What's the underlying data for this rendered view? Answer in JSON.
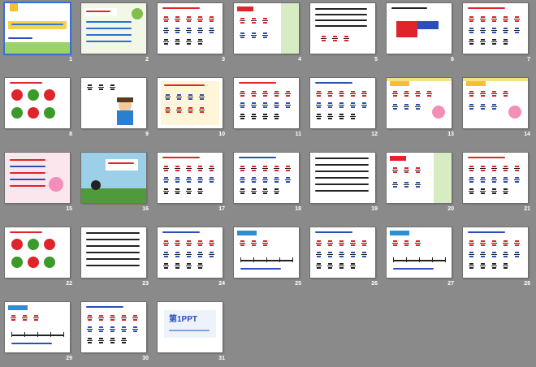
{
  "slide_sorter": {
    "slides": [
      {
        "number": "1",
        "style": "title",
        "bg": "#ffffff"
      },
      {
        "number": "2",
        "style": "goals",
        "bg": "#f3f7e8"
      },
      {
        "number": "3",
        "style": "fractions",
        "bg": "#ffffff"
      },
      {
        "number": "4",
        "style": "fractions-bamboo",
        "bg": "#ffffff"
      },
      {
        "number": "5",
        "style": "word-problem",
        "bg": "#ffffff"
      },
      {
        "number": "6",
        "style": "rect-diagram",
        "bg": "#ffffff"
      },
      {
        "number": "7",
        "style": "fractions",
        "bg": "#ffffff"
      },
      {
        "number": "8",
        "style": "circle-fractions",
        "bg": "#ffffff"
      },
      {
        "number": "9",
        "style": "boy",
        "bg": "#ffffff"
      },
      {
        "number": "10",
        "style": "fractions-frame",
        "bg": "#ffffff"
      },
      {
        "number": "11",
        "style": "fractions",
        "bg": "#ffffff"
      },
      {
        "number": "12",
        "style": "fractions",
        "bg": "#ffffff"
      },
      {
        "number": "13",
        "style": "fractions-mascot",
        "bg": "#ffffff"
      },
      {
        "number": "14",
        "style": "fractions-mascot",
        "bg": "#ffffff"
      },
      {
        "number": "15",
        "style": "summary",
        "bg": "#fbe6ee"
      },
      {
        "number": "16",
        "style": "scene",
        "bg": "#9ccfe8"
      },
      {
        "number": "17",
        "style": "fractions",
        "bg": "#ffffff"
      },
      {
        "number": "18",
        "style": "fractions",
        "bg": "#ffffff"
      },
      {
        "number": "19",
        "style": "text",
        "bg": "#ffffff"
      },
      {
        "number": "20",
        "style": "fractions-bamboo",
        "bg": "#ffffff"
      },
      {
        "number": "21",
        "style": "fractions",
        "bg": "#ffffff"
      },
      {
        "number": "22",
        "style": "circle-fractions",
        "bg": "#ffffff"
      },
      {
        "number": "23",
        "style": "text",
        "bg": "#ffffff"
      },
      {
        "number": "24",
        "style": "fractions",
        "bg": "#ffffff"
      },
      {
        "number": "25",
        "style": "number-line",
        "bg": "#ffffff"
      },
      {
        "number": "26",
        "style": "fractions",
        "bg": "#ffffff"
      },
      {
        "number": "27",
        "style": "number-line",
        "bg": "#ffffff"
      },
      {
        "number": "28",
        "style": "fractions",
        "bg": "#ffffff"
      },
      {
        "number": "29",
        "style": "number-line",
        "bg": "#ffffff"
      },
      {
        "number": "30",
        "style": "fractions",
        "bg": "#ffffff"
      },
      {
        "number": "31",
        "style": "logo",
        "bg": "#ffffff"
      }
    ],
    "logo_text": "第1PPT"
  },
  "colors": {
    "background": "#8a8a8a",
    "accent_red": "#e0242b",
    "accent_blue": "#2b4fb8",
    "accent_green": "#3a9a2a"
  }
}
